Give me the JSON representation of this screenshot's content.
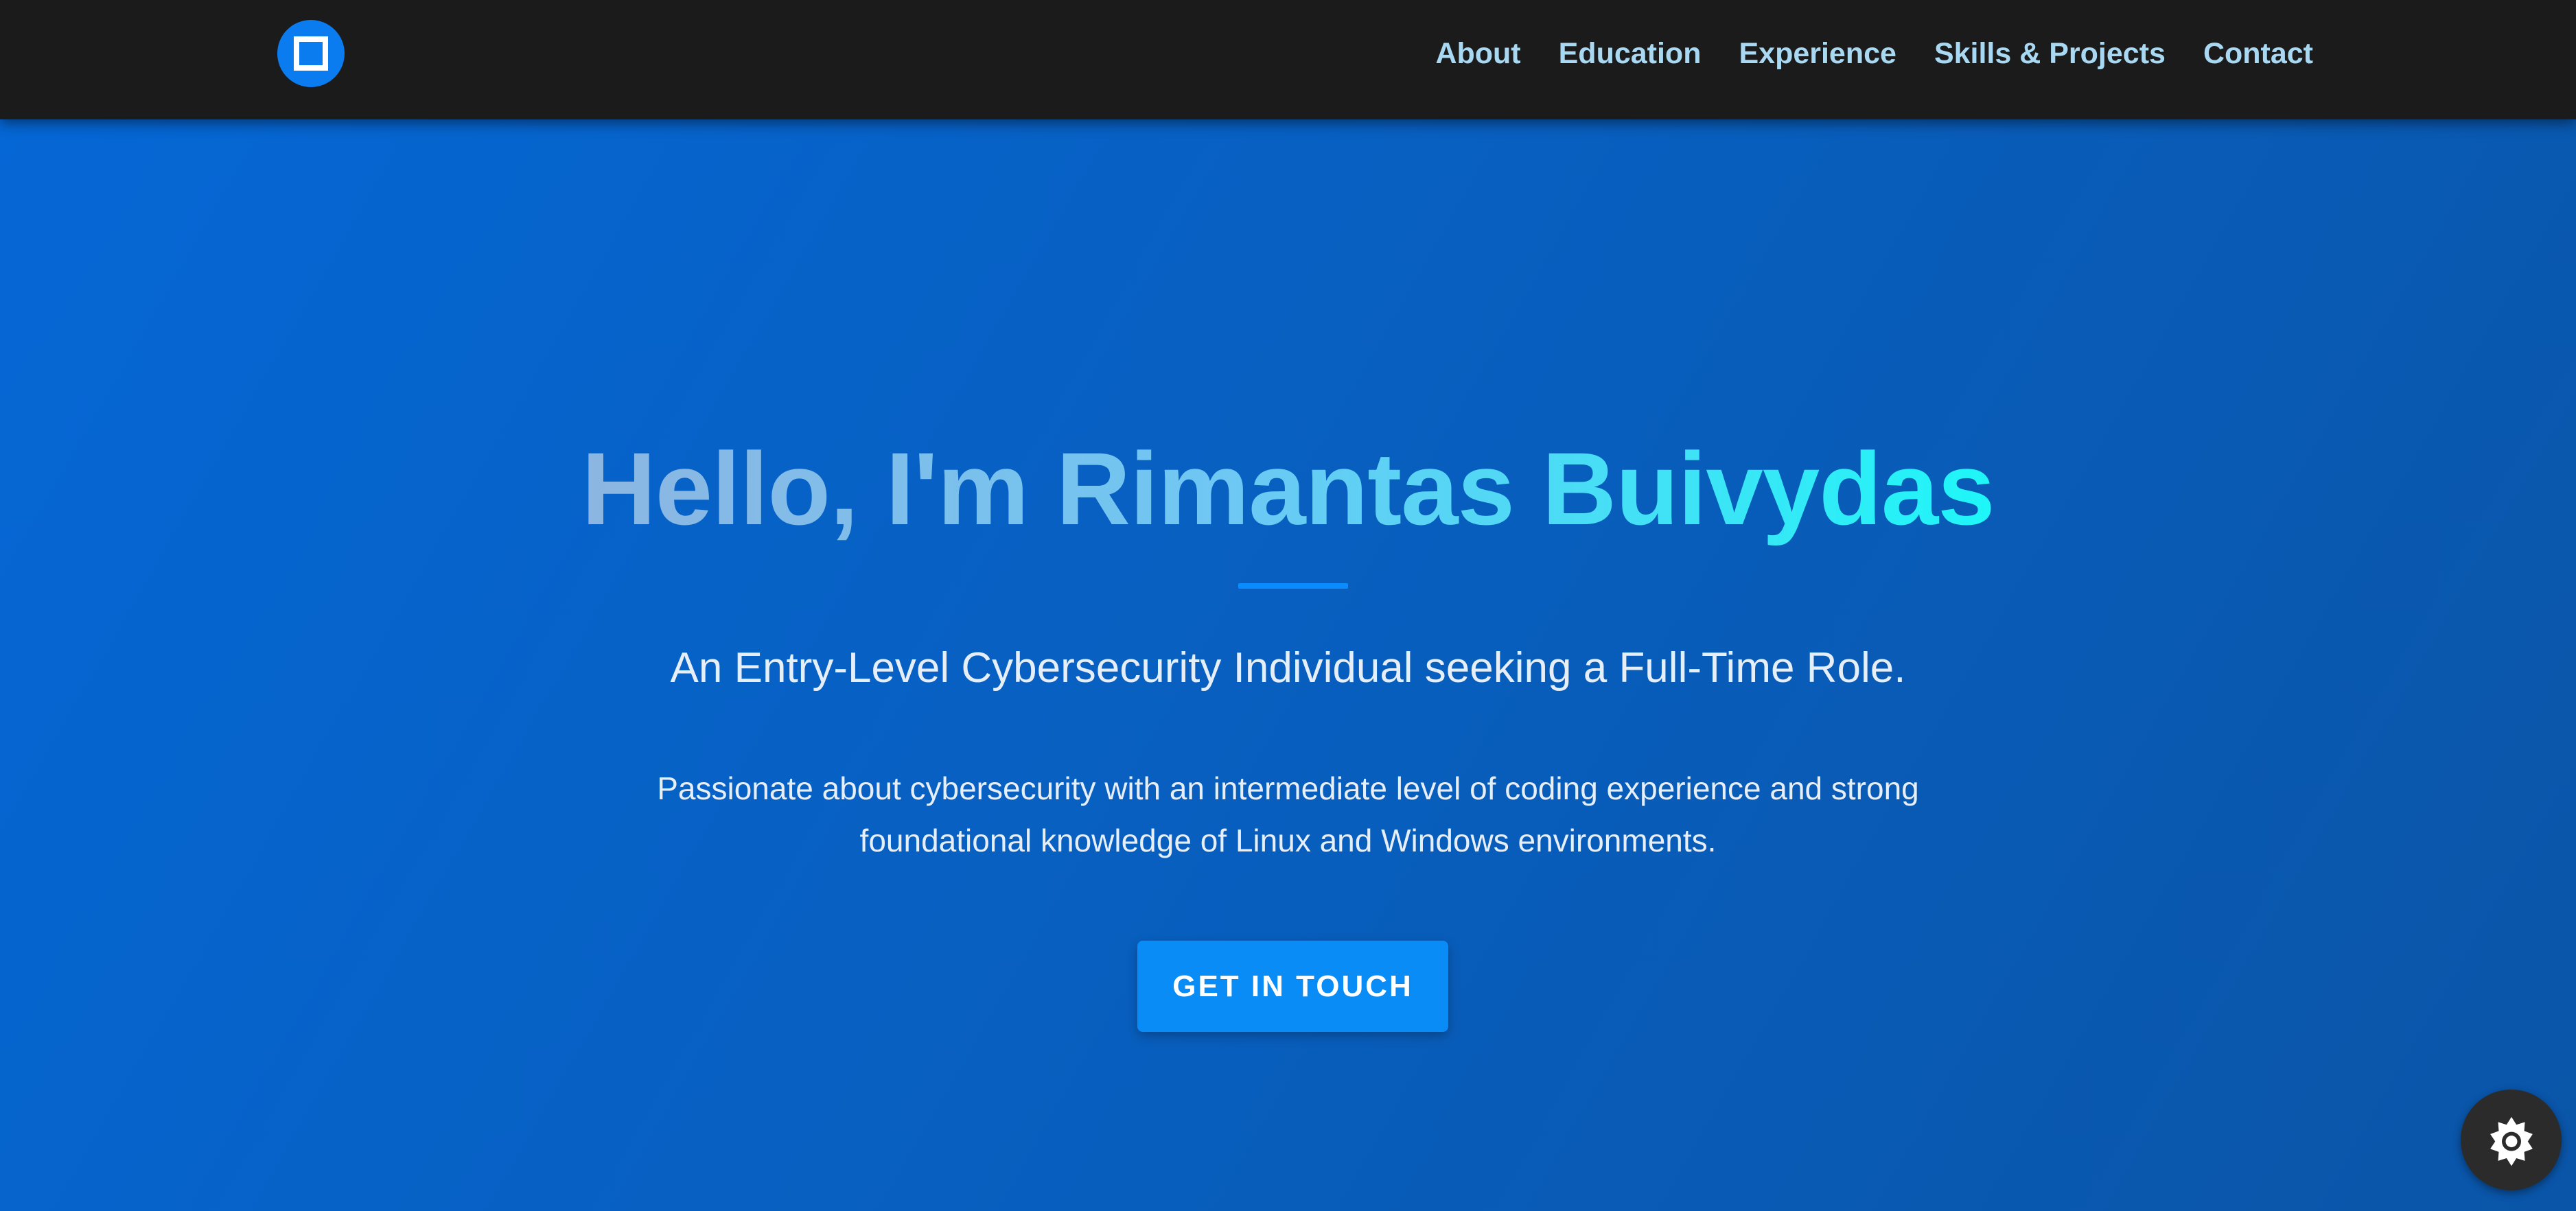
{
  "header": {
    "logo_icon": "square-icon",
    "nav": [
      {
        "label": "About"
      },
      {
        "label": "Education"
      },
      {
        "label": "Experience"
      },
      {
        "label": "Skills & Projects"
      },
      {
        "label": "Contact"
      }
    ]
  },
  "hero": {
    "title": "Hello, I'm Rimantas Buivydas",
    "subtitle": "An Entry-Level Cybersecurity Individual seeking a Full-Time Role.",
    "description": "Passionate about cybersecurity with an intermediate level of coding experience and strong foundational knowledge of Linux and Windows environments.",
    "cta_label": "GET IN TOUCH"
  },
  "settings_button": {
    "icon": "gear-icon"
  },
  "colors": {
    "nav_background": "#1b1b1b",
    "nav_link": "#a9d9f2",
    "accent": "#0a8cf6",
    "title_gradient_start": "#8db6e2",
    "title_gradient_end": "#1ef6f8",
    "hero_background": "#0567d6"
  }
}
